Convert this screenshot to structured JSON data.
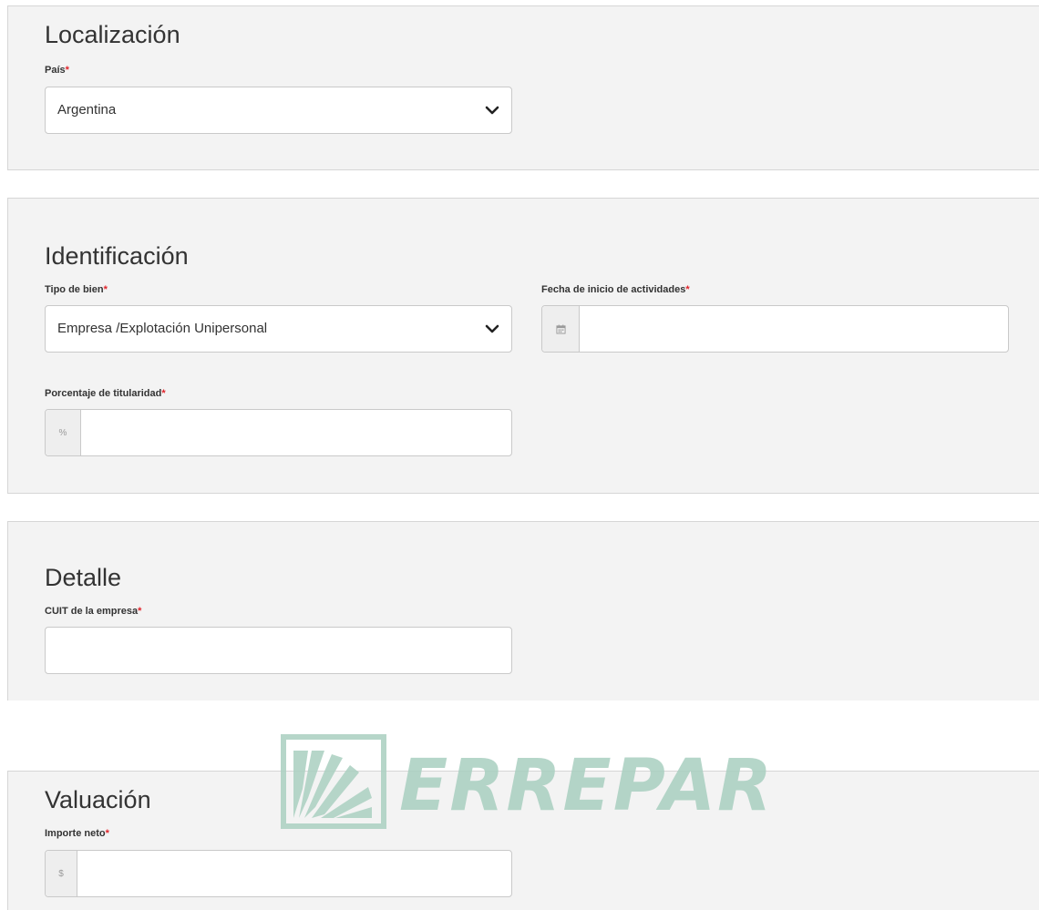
{
  "sections": {
    "localizacion": {
      "title": "Localización",
      "pais": {
        "label": "País",
        "required_mark": "*",
        "value": "Argentina"
      }
    },
    "identificacion": {
      "title": "Identificación",
      "tipo_de_bien": {
        "label": "Tipo de bien",
        "required_mark": "*",
        "value": "Empresa /Explotación Unipersonal"
      },
      "fecha_inicio": {
        "label": "Fecha de inicio de actividades",
        "required_mark": "*",
        "value": "",
        "icon": "calendar-icon"
      },
      "porcentaje": {
        "label": "Porcentaje de titularidad",
        "required_mark": "*",
        "value": "",
        "addon": "%"
      }
    },
    "detalle": {
      "title": "Detalle",
      "cuit": {
        "label": "CUIT de la empresa",
        "required_mark": "*",
        "value": ""
      }
    },
    "valuacion": {
      "title": "Valuación",
      "importe_neto": {
        "label": "Importe neto",
        "required_mark": "*",
        "value": "",
        "addon": "$"
      }
    }
  },
  "watermark": {
    "text": "ERREPAR",
    "color": "#a9cfc0"
  },
  "colors": {
    "required": "#e0242b",
    "section_bg": "#f3f3f3",
    "border": "#c9c9c9"
  }
}
